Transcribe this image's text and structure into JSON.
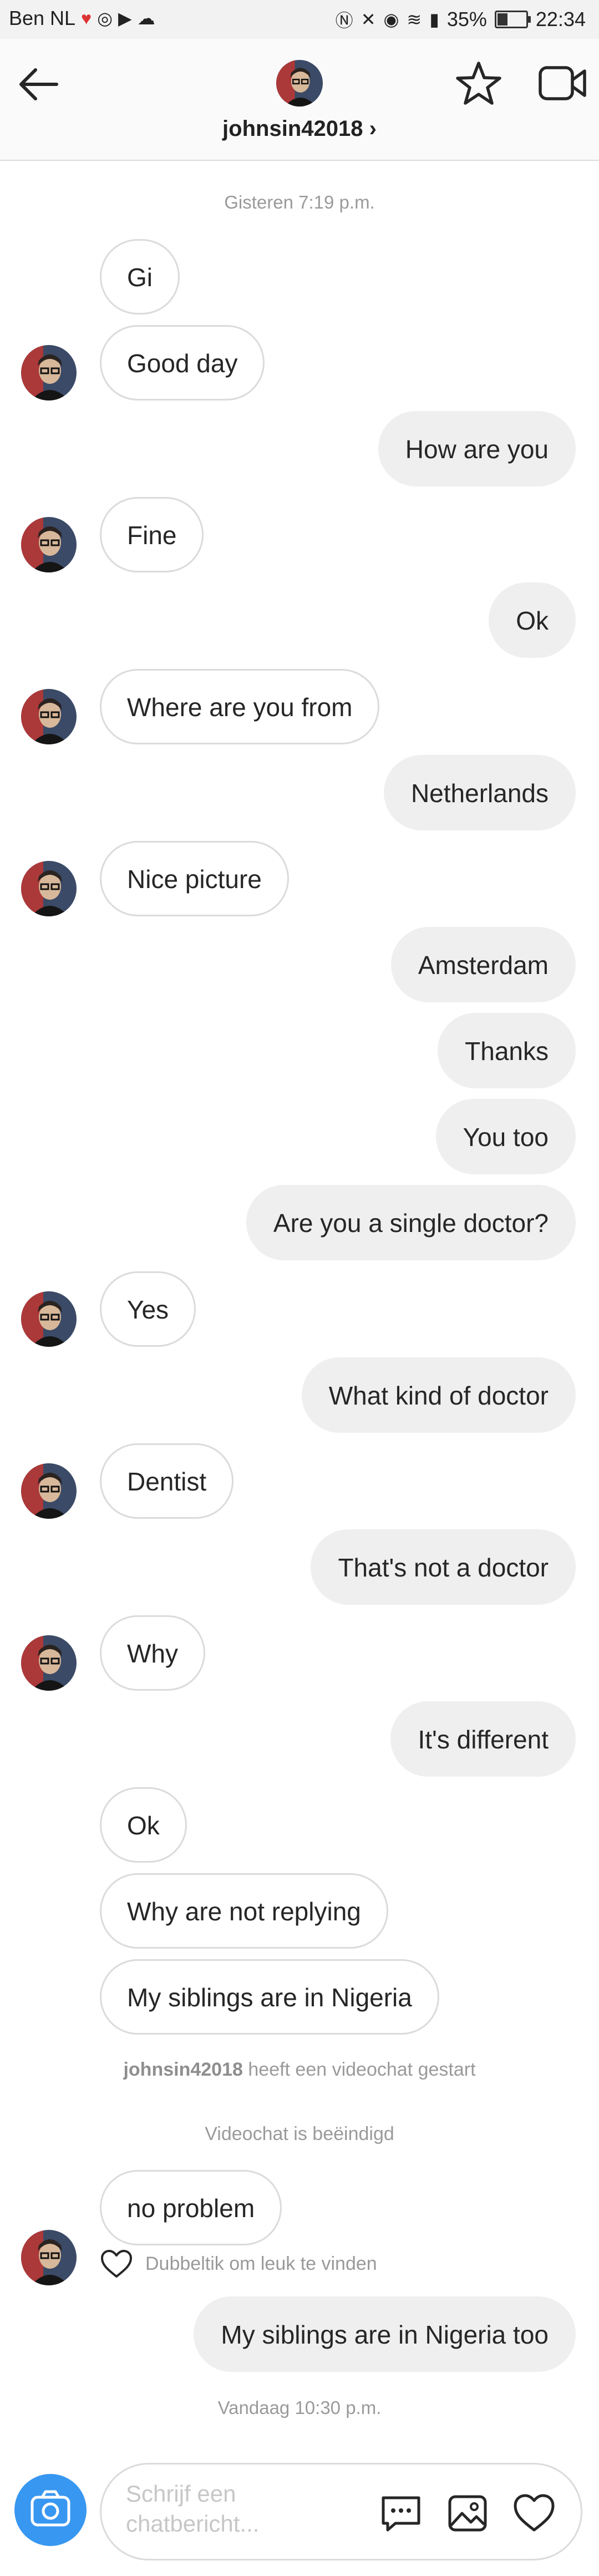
{
  "status_bar": {
    "carrier": "Ben NL",
    "battery": "35%",
    "time": "22:34"
  },
  "header": {
    "username": "johnsin42018",
    "chevron": "›"
  },
  "timestamps": {
    "first": "Gisteren 7:19 p.m.",
    "last": "Vandaag 10:30 p.m."
  },
  "messages": [
    {
      "text": "Gi"
    },
    {
      "text": "Good day"
    },
    {
      "text": "How are you"
    },
    {
      "text": "Fine"
    },
    {
      "text": "Ok"
    },
    {
      "text": "Where are you from"
    },
    {
      "text": "Netherlands"
    },
    {
      "text": "Nice picture"
    },
    {
      "text": "Amsterdam"
    },
    {
      "text": "Thanks"
    },
    {
      "text": "You too"
    },
    {
      "text": "Are you a single doctor?"
    },
    {
      "text": "Yes"
    },
    {
      "text": "What kind of doctor"
    },
    {
      "text": "Dentist"
    },
    {
      "text": "That's not a doctor"
    },
    {
      "text": "Why"
    },
    {
      "text": "It's different"
    },
    {
      "text": "Ok"
    },
    {
      "text": "Why are not replying"
    },
    {
      "text": "My siblings are in Nigeria"
    },
    {
      "text": "no problem"
    },
    {
      "text": "My siblings are in Nigeria too"
    }
  ],
  "system": {
    "videochat_user": "johnsin42018",
    "videochat_started": "heeft een videochat gestart",
    "videochat_ended": "Videochat is beëindigd"
  },
  "like_hint": "Dubbeltik om leuk te vinden",
  "composer": {
    "placeholder": "Schrijf een chatbericht..."
  },
  "colors": {
    "accent": "#3897f0",
    "outgoing_bubble": "#efefef",
    "incoming_border": "#dbdbdb"
  },
  "icons": [
    "back-arrow-icon",
    "star-icon",
    "video-camera-icon",
    "camera-icon",
    "chat-dots-icon",
    "image-icon",
    "heart-icon",
    "chevron-right-icon"
  ]
}
